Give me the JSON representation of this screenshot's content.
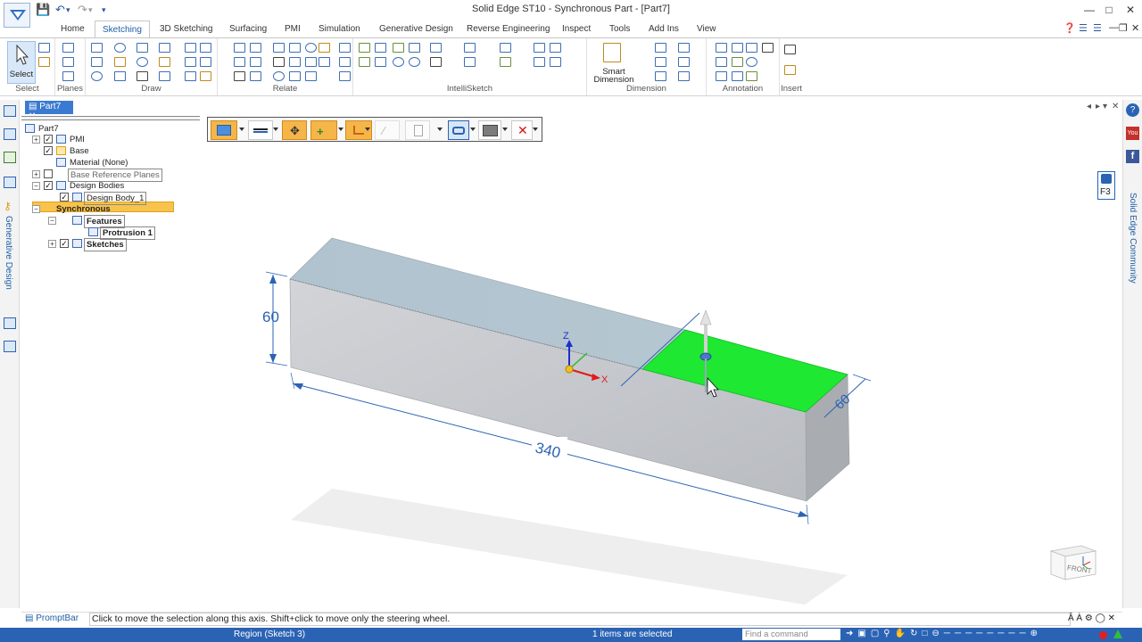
{
  "window": {
    "title": "Solid Edge ST10 - Synchronous Part - [Part7]"
  },
  "ribbon_tabs": [
    "Home",
    "Sketching",
    "3D Sketching",
    "Surfacing",
    "PMI",
    "Simulation",
    "Generative Design",
    "Reverse Engineering",
    "Inspect",
    "Tools",
    "Add Ins",
    "View"
  ],
  "active_tab": "Sketching",
  "ribbon_groups": {
    "select": "Select",
    "planes": "Planes",
    "draw": "Draw",
    "relate": "Relate",
    "intellisketch": "IntelliSketch",
    "dimension": "Dimension",
    "annotation": "Annotation",
    "insert": "Insert"
  },
  "buttons": {
    "select": "Select",
    "smart_dimension_1": "Smart",
    "smart_dimension_2": "Dimension"
  },
  "document_tab": "Part7",
  "tree": {
    "root": "Part7",
    "pmi": "PMI",
    "base": "Base",
    "material": "Material (None)",
    "base_ref_planes": "Base Reference Planes",
    "design_bodies": "Design Bodies",
    "design_body_1": "Design Body_1",
    "synchronous": "Synchronous",
    "features": "Features",
    "protrusion_1": "Protrusion 1",
    "sketches": "Sketches"
  },
  "side_panels": {
    "left": "Generative Design",
    "right": "Solid Edge Community",
    "lock_key": "F3"
  },
  "model": {
    "dim_height": "60",
    "dim_length": "340",
    "dim_width": "60",
    "axis_z": "Z",
    "axis_x": "X",
    "highlight_color": "#1ee832",
    "body_color": "#d4d6da"
  },
  "view_cube": {
    "front": "FRONT"
  },
  "prompt": {
    "label": "PromptBar",
    "text": "Click to move the selection along this axis.  Shift+click to move only the steering wheel."
  },
  "status": {
    "left": "Region (Sketch 3)",
    "middle": "1 items are selected",
    "find_placeholder": "Find a command"
  }
}
